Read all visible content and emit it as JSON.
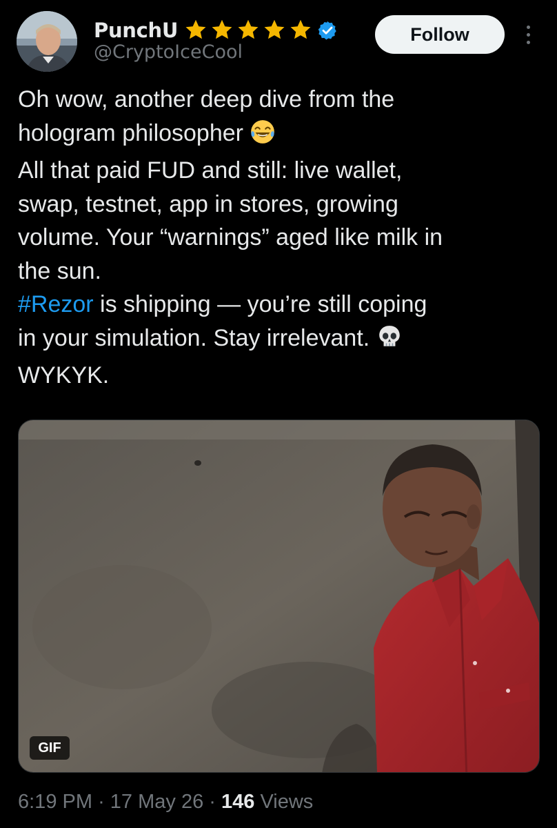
{
  "author": {
    "display_name": "PunchU",
    "handle": "@CryptoIceCool",
    "star_count": 5,
    "star_color": "#f5b700",
    "verified": true,
    "verified_color": "#1d9bf0",
    "avatar_icon": "person-photo"
  },
  "actions": {
    "follow_label": "Follow",
    "more_icon": "more-vertical-icon"
  },
  "tweet": {
    "line1": "Oh wow, another deep dive from the",
    "line2": "hologram philosopher",
    "line2_emoji": "laughing-tears-emoji",
    "line3": "All that paid FUD and still: live wallet,",
    "line4": "swap, testnet, app in stores, growing",
    "line5": "volume. Your “warnings” aged like milk in",
    "line6": "the sun.",
    "line7_hashtag": "#Rezor",
    "line7_rest": " is shipping — you’re still coping",
    "line8": "in your simulation. Stay irrelevant. ",
    "line8_emoji": "skull-emoji",
    "line9": "WYKYK.",
    "hashtag_color": "#1d9bf0"
  },
  "media": {
    "type": "GIF",
    "badge_label": "GIF",
    "description_icon": "gif-man-red-shirt"
  },
  "meta": {
    "time": "6:19 PM",
    "separator": "·",
    "date": "17 May 26",
    "views_count": "146",
    "views_label": "Views"
  },
  "colors": {
    "background": "#000000",
    "text": "#e7e9ea",
    "muted": "#71767b",
    "follow_bg": "#eff3f4"
  }
}
